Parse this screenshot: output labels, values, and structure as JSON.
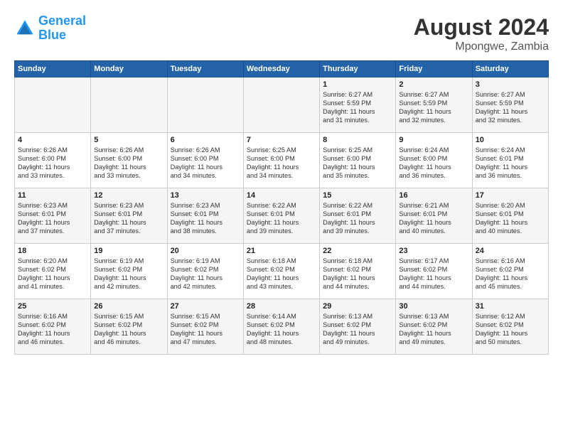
{
  "header": {
    "logo_line1": "General",
    "logo_line2": "Blue",
    "main_title": "August 2024",
    "sub_title": "Mpongwe, Zambia"
  },
  "days_of_week": [
    "Sunday",
    "Monday",
    "Tuesday",
    "Wednesday",
    "Thursday",
    "Friday",
    "Saturday"
  ],
  "weeks": [
    [
      {
        "day": "",
        "info": ""
      },
      {
        "day": "",
        "info": ""
      },
      {
        "day": "",
        "info": ""
      },
      {
        "day": "",
        "info": ""
      },
      {
        "day": "1",
        "info": "Sunrise: 6:27 AM\nSunset: 5:59 PM\nDaylight: 11 hours\nand 31 minutes."
      },
      {
        "day": "2",
        "info": "Sunrise: 6:27 AM\nSunset: 5:59 PM\nDaylight: 11 hours\nand 32 minutes."
      },
      {
        "day": "3",
        "info": "Sunrise: 6:27 AM\nSunset: 5:59 PM\nDaylight: 11 hours\nand 32 minutes."
      }
    ],
    [
      {
        "day": "4",
        "info": "Sunrise: 6:26 AM\nSunset: 6:00 PM\nDaylight: 11 hours\nand 33 minutes."
      },
      {
        "day": "5",
        "info": "Sunrise: 6:26 AM\nSunset: 6:00 PM\nDaylight: 11 hours\nand 33 minutes."
      },
      {
        "day": "6",
        "info": "Sunrise: 6:26 AM\nSunset: 6:00 PM\nDaylight: 11 hours\nand 34 minutes."
      },
      {
        "day": "7",
        "info": "Sunrise: 6:25 AM\nSunset: 6:00 PM\nDaylight: 11 hours\nand 34 minutes."
      },
      {
        "day": "8",
        "info": "Sunrise: 6:25 AM\nSunset: 6:00 PM\nDaylight: 11 hours\nand 35 minutes."
      },
      {
        "day": "9",
        "info": "Sunrise: 6:24 AM\nSunset: 6:00 PM\nDaylight: 11 hours\nand 36 minutes."
      },
      {
        "day": "10",
        "info": "Sunrise: 6:24 AM\nSunset: 6:01 PM\nDaylight: 11 hours\nand 36 minutes."
      }
    ],
    [
      {
        "day": "11",
        "info": "Sunrise: 6:23 AM\nSunset: 6:01 PM\nDaylight: 11 hours\nand 37 minutes."
      },
      {
        "day": "12",
        "info": "Sunrise: 6:23 AM\nSunset: 6:01 PM\nDaylight: 11 hours\nand 37 minutes."
      },
      {
        "day": "13",
        "info": "Sunrise: 6:23 AM\nSunset: 6:01 PM\nDaylight: 11 hours\nand 38 minutes."
      },
      {
        "day": "14",
        "info": "Sunrise: 6:22 AM\nSunset: 6:01 PM\nDaylight: 11 hours\nand 39 minutes."
      },
      {
        "day": "15",
        "info": "Sunrise: 6:22 AM\nSunset: 6:01 PM\nDaylight: 11 hours\nand 39 minutes."
      },
      {
        "day": "16",
        "info": "Sunrise: 6:21 AM\nSunset: 6:01 PM\nDaylight: 11 hours\nand 40 minutes."
      },
      {
        "day": "17",
        "info": "Sunrise: 6:20 AM\nSunset: 6:01 PM\nDaylight: 11 hours\nand 40 minutes."
      }
    ],
    [
      {
        "day": "18",
        "info": "Sunrise: 6:20 AM\nSunset: 6:02 PM\nDaylight: 11 hours\nand 41 minutes."
      },
      {
        "day": "19",
        "info": "Sunrise: 6:19 AM\nSunset: 6:02 PM\nDaylight: 11 hours\nand 42 minutes."
      },
      {
        "day": "20",
        "info": "Sunrise: 6:19 AM\nSunset: 6:02 PM\nDaylight: 11 hours\nand 42 minutes."
      },
      {
        "day": "21",
        "info": "Sunrise: 6:18 AM\nSunset: 6:02 PM\nDaylight: 11 hours\nand 43 minutes."
      },
      {
        "day": "22",
        "info": "Sunrise: 6:18 AM\nSunset: 6:02 PM\nDaylight: 11 hours\nand 44 minutes."
      },
      {
        "day": "23",
        "info": "Sunrise: 6:17 AM\nSunset: 6:02 PM\nDaylight: 11 hours\nand 44 minutes."
      },
      {
        "day": "24",
        "info": "Sunrise: 6:16 AM\nSunset: 6:02 PM\nDaylight: 11 hours\nand 45 minutes."
      }
    ],
    [
      {
        "day": "25",
        "info": "Sunrise: 6:16 AM\nSunset: 6:02 PM\nDaylight: 11 hours\nand 46 minutes."
      },
      {
        "day": "26",
        "info": "Sunrise: 6:15 AM\nSunset: 6:02 PM\nDaylight: 11 hours\nand 46 minutes."
      },
      {
        "day": "27",
        "info": "Sunrise: 6:15 AM\nSunset: 6:02 PM\nDaylight: 11 hours\nand 47 minutes."
      },
      {
        "day": "28",
        "info": "Sunrise: 6:14 AM\nSunset: 6:02 PM\nDaylight: 11 hours\nand 48 minutes."
      },
      {
        "day": "29",
        "info": "Sunrise: 6:13 AM\nSunset: 6:02 PM\nDaylight: 11 hours\nand 49 minutes."
      },
      {
        "day": "30",
        "info": "Sunrise: 6:13 AM\nSunset: 6:02 PM\nDaylight: 11 hours\nand 49 minutes."
      },
      {
        "day": "31",
        "info": "Sunrise: 6:12 AM\nSunset: 6:02 PM\nDaylight: 11 hours\nand 50 minutes."
      }
    ]
  ]
}
